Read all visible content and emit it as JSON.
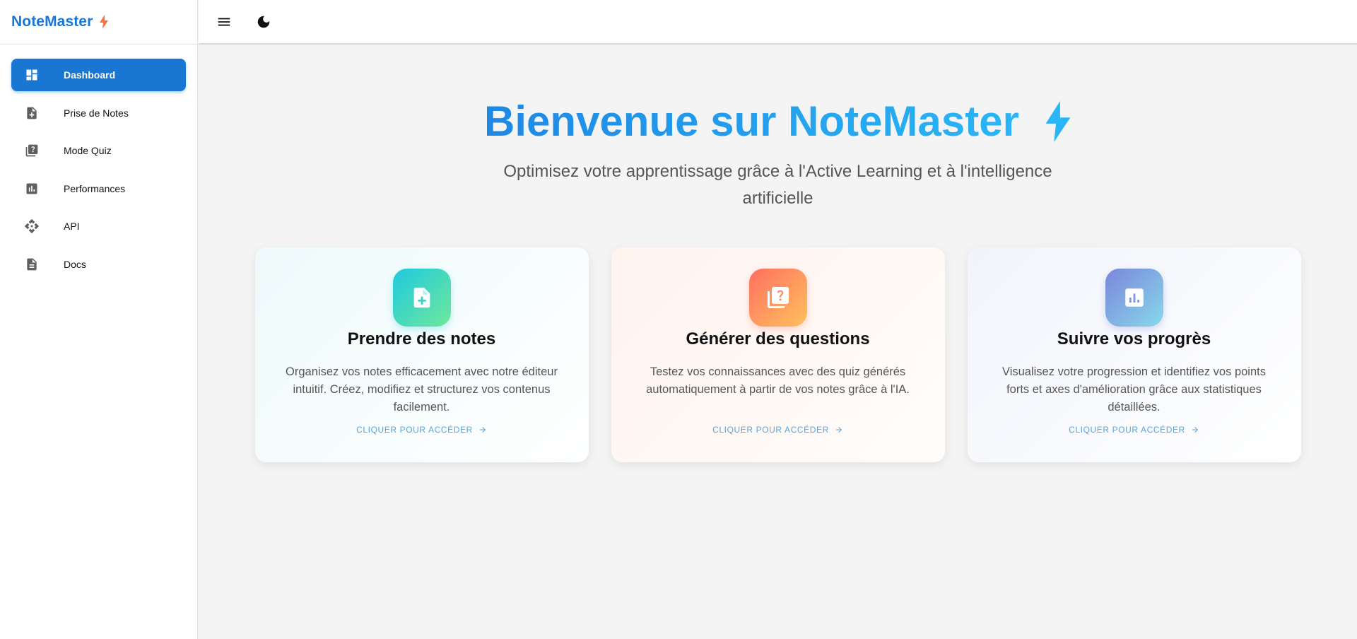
{
  "brand": {
    "name": "NoteMaster",
    "bolt_icon": "bolt-icon",
    "accent": "#1976d2",
    "bolt_color": "#ff7043"
  },
  "sidebar": {
    "items": [
      {
        "label": "Dashboard",
        "icon": "dashboard-icon",
        "active": true
      },
      {
        "label": "Prise de Notes",
        "icon": "note-add-icon",
        "active": false
      },
      {
        "label": "Mode Quiz",
        "icon": "quiz-icon",
        "active": false
      },
      {
        "label": "Performances",
        "icon": "bar-chart-icon",
        "active": false
      },
      {
        "label": "API",
        "icon": "api-icon",
        "active": false
      },
      {
        "label": "Docs",
        "icon": "document-icon",
        "active": false
      }
    ]
  },
  "topbar": {
    "menu_icon": "menu-icon",
    "theme_icon": "dark-mode-icon"
  },
  "hero": {
    "title": "Bienvenue sur NoteMaster",
    "subtitle": "Optimisez votre apprentissage grâce à l'Active Learning et à l'intelligence artificielle",
    "bolt_color": "#29b6f6"
  },
  "cards": [
    {
      "title": "Prendre des notes",
      "description": "Organisez vos notes efficacement avec notre éditeur intuitif. Créez, modifiez et structurez vos contenus facilement.",
      "link": "CLIQUER POUR ACCÉDER",
      "icon": "note-add-icon"
    },
    {
      "title": "Générer des questions",
      "description": "Testez vos connaissances avec des quiz générés automatiquement à partir de vos notes grâce à l'IA.",
      "link": "CLIQUER POUR ACCÉDER",
      "icon": "quiz-icon"
    },
    {
      "title": "Suivre vos progrès",
      "description": "Visualisez votre progression et identifiez vos points forts et axes d'amélioration grâce aux statistiques détaillées.",
      "link": "CLIQUER POUR ACCÉDER",
      "icon": "analytics-icon"
    }
  ]
}
